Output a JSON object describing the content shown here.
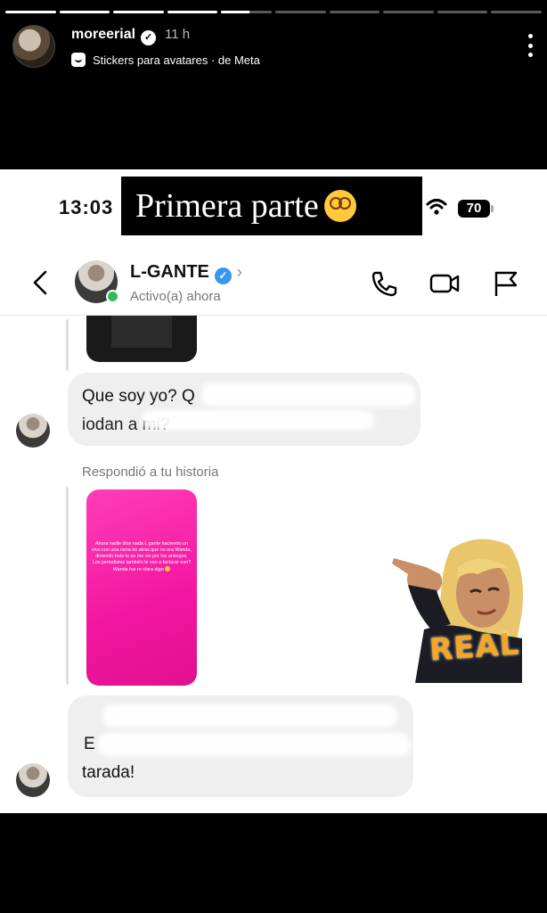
{
  "story": {
    "progress_segments": [
      1,
      1,
      1,
      1,
      0.55,
      0,
      0,
      0,
      0,
      0
    ],
    "username": "moreerial",
    "time": "11 h",
    "subtitle": "Stickers para avatares · de Meta"
  },
  "screenshot": {
    "status_time": "13:03",
    "caption": "Primera parte",
    "battery": "70",
    "chat": {
      "name": "L-GANTE",
      "status": "Activo(a) ahora",
      "messages": [
        {
          "text_line1": "Que soy yo? Q",
          "text_line2": "iodan a mi?"
        },
        {
          "replied_label": "Respondió a tu historia",
          "story_text": "Ahora nadie dice nada L gante haciendo un vivo con una nena de atrás que no era Wanda, diciendo todo lo se me vio por los anteojos. Los periodistas también le van a facturar eso? Wanda fue re clara digo"
        },
        {
          "text_line1": "E",
          "text_line2": "tarada!"
        }
      ]
    },
    "sticker_text": "REAL"
  }
}
